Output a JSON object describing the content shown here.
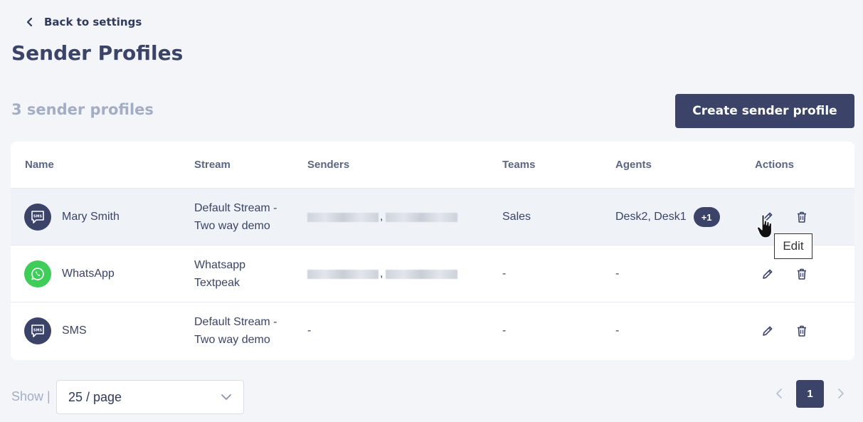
{
  "header": {
    "back_label": "Back to settings",
    "title": "Sender Profiles"
  },
  "toolbar": {
    "count_label": "3 sender profiles",
    "create_label": "Create sender profile"
  },
  "table": {
    "columns": [
      "Name",
      "Stream",
      "Senders",
      "Teams",
      "Agents",
      "Actions"
    ],
    "rows": [
      {
        "name": "Mary Smith",
        "icon": "sms-icon",
        "stream": [
          "Default Stream -",
          "Two way demo"
        ],
        "senders": "redacted",
        "teams": "Sales",
        "agents": [
          "Desk2,",
          "Desk1"
        ],
        "agents_more": "+1"
      },
      {
        "name": "WhatsApp",
        "icon": "whatsapp-icon",
        "stream": [
          "Whatsapp",
          "Textpeak"
        ],
        "senders": "redacted",
        "teams": "-",
        "agents_text": "-"
      },
      {
        "name": "SMS",
        "icon": "sms-icon",
        "stream": [
          "Default Stream -",
          "Two way demo"
        ],
        "senders_text": "-",
        "teams": "-",
        "agents_text": "-"
      }
    ]
  },
  "tooltip": {
    "text": "Edit"
  },
  "pagination": {
    "show_label": "Show |",
    "page_size": "25 / page",
    "current_page": "1"
  },
  "colors": {
    "primary": "#3b4468",
    "whatsapp": "#3fcd59",
    "muted": "#a3adc4",
    "background": "#f4f5f9"
  }
}
